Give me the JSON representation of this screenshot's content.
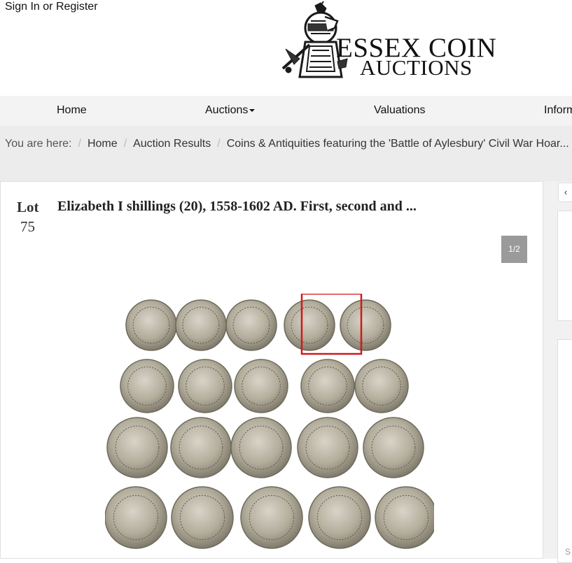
{
  "header": {
    "signin": "Sign In",
    "or": "or",
    "register": "Register",
    "logo_line1": "ESSEX COIN",
    "logo_line2": "AUCTIONS"
  },
  "nav": {
    "items": [
      {
        "label": "Home"
      },
      {
        "label": "Auctions"
      },
      {
        "label": "Valuations"
      },
      {
        "label": "Inform"
      }
    ]
  },
  "breadcrumb": {
    "prefix": "You are here:",
    "items": [
      {
        "label": "Home"
      },
      {
        "label": "Auction Results"
      },
      {
        "label": "Coins & Antiquities featuring the 'Battle of Aylesbury' Civil War Hoar..."
      }
    ]
  },
  "lot": {
    "label": "Lot",
    "number": "75",
    "title": "Elizabeth I shillings (20), 1558-1602 AD. First, second and ...",
    "image_counter": "1/2"
  },
  "sidebar": {
    "prev_icon": "chevron-left-icon",
    "partial_text": "S"
  },
  "colors": {
    "nav_bg": "#f3f3f3",
    "breadcrumb_bg": "#ececec",
    "counter_bg": "#9a9a9a",
    "highlight": "#d0191c"
  }
}
